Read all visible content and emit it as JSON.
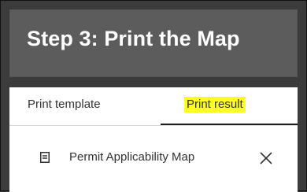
{
  "header": {
    "title": "Step 3: Print the Map"
  },
  "tabs": [
    {
      "label": "Print template",
      "active": false
    },
    {
      "label": "Print result",
      "active": true,
      "highlighted": true
    }
  ],
  "result": {
    "label": "Permit Applicability Map",
    "icon": "document-icon",
    "close_icon": "close-icon"
  },
  "colors": {
    "header_bg": "#5c5c5c",
    "highlight": "#ffff22",
    "active_tab_indicator": "#1f1f1f"
  }
}
